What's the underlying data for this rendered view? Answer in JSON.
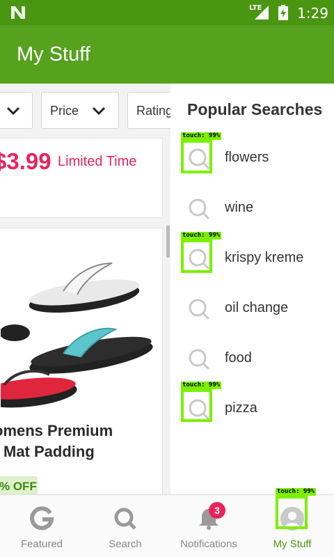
{
  "status_bar": {
    "network": "LTE",
    "time": "1:29",
    "icons": [
      "n-logo-icon",
      "signal-icon",
      "battery-charging-icon"
    ]
  },
  "app_bar": {
    "title": "My Stuff"
  },
  "filters": [
    {
      "label": ""
    },
    {
      "label": "Price"
    },
    {
      "label": "Rating"
    }
  ],
  "deal_card": {
    "price": "$3.99",
    "badge": "Limited Time"
  },
  "product_card": {
    "title_line1": "omens Premium",
    "title_line2": "Mat Padding",
    "discount": "% OFF"
  },
  "popular_searches": {
    "title": "Popular Searches",
    "items": [
      {
        "label": "flowers"
      },
      {
        "label": "wine"
      },
      {
        "label": "krispy kreme"
      },
      {
        "label": "oil change"
      },
      {
        "label": "food"
      },
      {
        "label": "pizza"
      }
    ]
  },
  "bottom_nav": {
    "items": [
      {
        "label": "Featured",
        "icon": "g-logo-icon"
      },
      {
        "label": "Search",
        "icon": "search-icon"
      },
      {
        "label": "Notifications",
        "icon": "bell-icon",
        "badge": "3"
      },
      {
        "label": "My Stuff",
        "icon": "user-icon"
      }
    ],
    "active": "My Stuff"
  },
  "detections": [
    {
      "label": "touch: 99%"
    },
    {
      "label": "touch: 99%"
    },
    {
      "label": "touch: 99%"
    },
    {
      "label": "touch: 99%"
    }
  ],
  "colors": {
    "status_bar": "#4a9512",
    "app_bar": "#56a11e",
    "accent_pink": "#e8245b",
    "active_green": "#4a9512",
    "detection": "#7cf000"
  }
}
